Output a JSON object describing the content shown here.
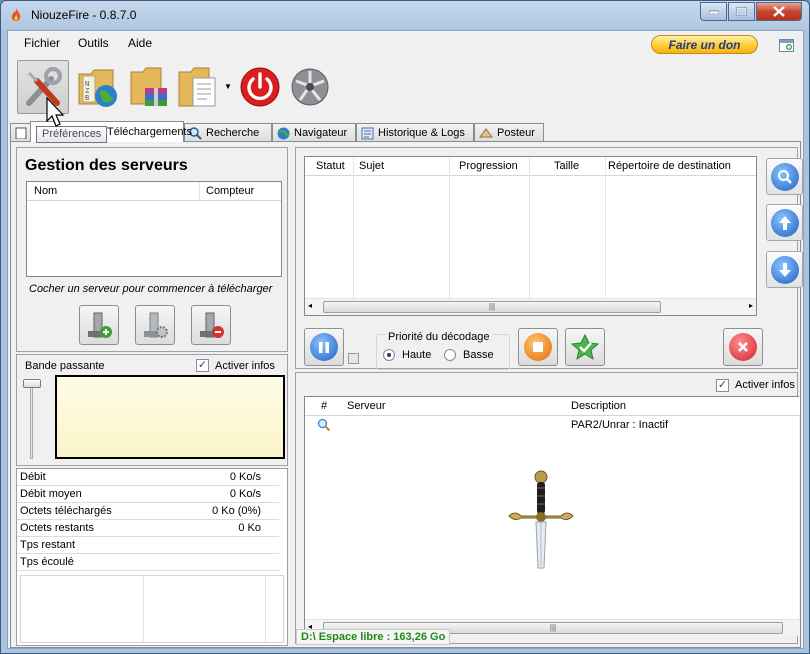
{
  "window": {
    "title": "NiouzeFire - 0.8.7.0",
    "controls": [
      "minimize",
      "maximize",
      "close"
    ]
  },
  "menu": {
    "file": "Fichier",
    "tools": "Outils",
    "help": "Aide"
  },
  "donate": {
    "label": "Faire un don"
  },
  "toolbar": {
    "tooltip": "Préférences",
    "buttons": [
      "preferences-tools-icon",
      "nzb-folder-icon",
      "rar-folder-icon",
      "document-folder-icon",
      "power-icon",
      "shutter-icon"
    ]
  },
  "tabs": [
    {
      "label": "Téléchargements",
      "icon": "download-icon"
    },
    {
      "label": "Recherche",
      "icon": "search-icon"
    },
    {
      "label": "Navigateur",
      "icon": "globe-icon"
    },
    {
      "label": "Historique & Logs",
      "icon": "log-icon"
    },
    {
      "label": "Posteur",
      "icon": "upload-icon"
    }
  ],
  "servers": {
    "title": "Gestion des serveurs",
    "columns": [
      "Nom",
      "Compteur"
    ],
    "hint": "Cocher un serveur pour commencer à télécharger"
  },
  "bandwidth": {
    "title": "Bande passante",
    "activate_label": "Activer infos",
    "activate_checked": true
  },
  "stats": [
    {
      "key": "Débit",
      "value": "0 Ko/s"
    },
    {
      "key": "Débit moyen",
      "value": "0 Ko/s"
    },
    {
      "key": "Octets téléchargés",
      "value": "0 Ko (0%)"
    },
    {
      "key": "Octets restants",
      "value": "0 Ko"
    },
    {
      "key": "Tps restant",
      "value": ""
    },
    {
      "key": "Tps écoulé",
      "value": ""
    }
  ],
  "queue": {
    "columns": [
      "Statut",
      "Sujet",
      "Progression",
      "Taille",
      "Répertoire de destination"
    ]
  },
  "decoding": {
    "title": "Priorité du décodage",
    "high": "Haute",
    "low": "Basse",
    "selected": "Haute"
  },
  "log": {
    "activate_label": "Activer infos",
    "activate_checked": true,
    "columns": [
      "#",
      "Serveur",
      "Description"
    ],
    "rows": [
      {
        "num_icon": "magnifier-icon",
        "server": "",
        "description": "PAR2/Unrar : Inactif"
      }
    ]
  },
  "status": {
    "free_space": "D:\\ Espace libre : 163,26 Go"
  },
  "colors": {
    "accent": "#1d4a8b",
    "status_green": "#1e8a1e",
    "donate": "#ffcc33"
  }
}
